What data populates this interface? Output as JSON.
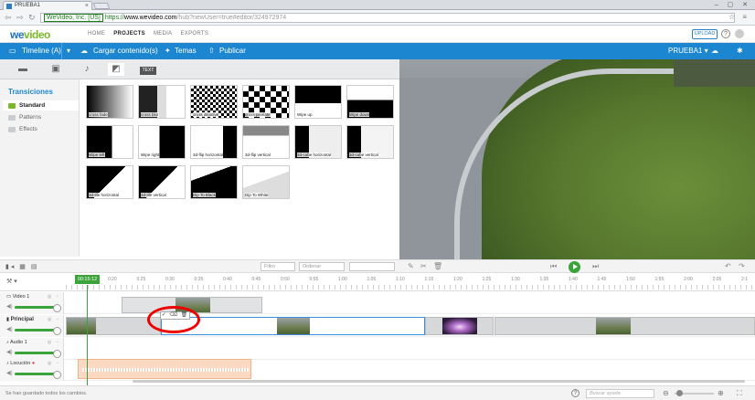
{
  "browser": {
    "tab_title": "PRUEBA1",
    "tab_close": "×",
    "window_controls": "– ▢ ✕",
    "url_secure_label": "WeVideo, Inc. [US]",
    "url_scheme": "https://",
    "url_host": "www.wevideo.com",
    "url_path": "/hub?newUser=true#editor/324972974"
  },
  "app": {
    "logo_main": "we",
    "logo_accent": "video",
    "nav": [
      "HOME",
      "PROJECTS",
      "MEDIA",
      "EXPORTS"
    ],
    "nav_active_index": 1,
    "upload_label": "UPLOAD",
    "help_label": "?"
  },
  "toolbar": {
    "timeline_label": "Timeline (A)",
    "upload_content_label": "Cargar contenido(s)",
    "themes_label": "Temas",
    "publish_label": "Publicar",
    "project_name": "PRUEBA1 ▾"
  },
  "media_tabs": [
    "video-camera",
    "image",
    "music-note",
    "transition",
    "text"
  ],
  "media_tab_active": 3,
  "media_tab_text_label": "TEXT",
  "sidebar": {
    "title": "Transiciones",
    "items": [
      {
        "label": "Standard",
        "active": true
      },
      {
        "label": "Patterns",
        "active": false
      },
      {
        "label": "Effects",
        "active": false
      }
    ]
  },
  "transitions": [
    "cross fade",
    "cross blur",
    "cross dissolve",
    "cross pixelate",
    "Wipe up",
    "Wipe down",
    "Wipe left",
    "Wipe right",
    "3d-flip horizontal",
    "3d-flip vertical",
    "3d-cube horizontal",
    "3d-cube vertical",
    "3d-tile horizontal",
    "3d-tile vertical",
    "Dip To Black",
    "Dip To White"
  ],
  "timeline_bar": {
    "filter_placeholder": "Filtro",
    "order_label": "Ordenar"
  },
  "ruler": {
    "playhead_time": "00:15:12",
    "ticks": [
      "0:20",
      "0:25",
      "0:30",
      "0:35",
      "0:40",
      "0:45",
      "0:50",
      "0:55",
      "1:00",
      "1:05",
      "1:10",
      "1:15",
      "1:20",
      "1:25",
      "1:30",
      "1:35",
      "1:40",
      "1:45",
      "1:50",
      "1:55",
      "2:00",
      "2:05",
      "2:1"
    ]
  },
  "tracks": [
    {
      "name": "Video 1",
      "bold": false
    },
    {
      "name": "Principal",
      "bold": true
    },
    {
      "name": "Audio 1",
      "bold": false
    },
    {
      "name": "Locución",
      "bold": false
    }
  ],
  "clip_popup_icons": "✓ ⌫ 🗑",
  "status": {
    "saved_text": "Se han guardado todos los cambios.",
    "search_placeholder": "Buscar ayuda"
  }
}
